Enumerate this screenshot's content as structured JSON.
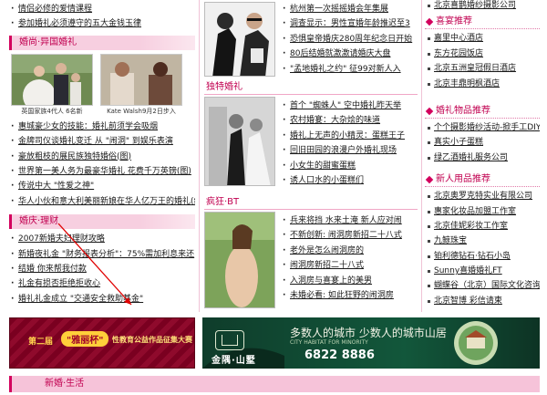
{
  "left": {
    "top_items": [
      "情侣必修的爱情课程",
      "参加婚礼必须遵守的五大金钱玉律"
    ],
    "section1_title": "婚尚·异国婚礼",
    "photos": [
      {
        "caption": "英国家族4代人 6名新"
      },
      {
        "caption": "Kate Walsh9月2日步入"
      }
    ],
    "section1_items": [
      "惠城豪少女的技能：婚礼前须学会吸烟",
      "金牌司仪谈婚礼变迁 从 \"闹洞\" 到娱乐表演",
      "豪放粗枝的展民族独特婚俗(图)",
      "世界第一美人务为最豪华婚礼 花费千万英镑(图)",
      "传说中大 \"性爱之神\"",
      "华人小伙和意大利美丽新娘在华人亿万王的婚礼(组图)"
    ],
    "section2_title": "婚庆·理财",
    "section2_items": [
      "2007新婚夫妇理财攻略",
      "新婚夜礼金 \"财务报表分析\"：75%需加利息来还",
      "结婚 你来帮我付款",
      "礼金有损否拒绝拒收心",
      "婚礼礼金成立 \"交通安全救助基金\""
    ]
  },
  "middle": {
    "block1_items": [
      "杭州第一次摇摇婚会年集展",
      "调查显示：男性宣婚年龄推迟至3",
      "恐惧皇帝婚庆280周年纪念日开始",
      "80后结婚就激激请婚庆大盘",
      "\"孟地婚礼之约\" 征99对新人入"
    ],
    "section2_title": "独特婚礼",
    "block2_items": [
      "首个 \"蜘蛛人\" 空中婚礼昨天举",
      "农村婚宴：大杂烩的味道",
      "婚礼上无声的小精灵：蛋糕王子",
      "回旧田园的浪漫户外婚礼现场",
      "小女生的甜蜜蛋糕",
      "诱人口水的小蛋糕们"
    ],
    "section3_title": "疯狂·BT",
    "block3_items": [
      "兵来将挡 水来土淹 新人应对闹",
      "不新创新: 闹洞房新招二十八式",
      "老外是怎么闹洞房的",
      "闹洞房新招二十八式",
      "入洞房与喜宴上的美男",
      "未婚必看: 如此狂野的闹洞房"
    ]
  },
  "right": {
    "top_items": [
      "北京喜鹊婚纱摄影公司"
    ],
    "section1_title": "喜宴推荐",
    "section1_items": [
      "嘉里中心酒店",
      "东方花园饭店",
      "北京五洲皇冠假日酒店",
      "北京丰鼎明枫酒店"
    ],
    "section2_title": "婚礼物品推荐",
    "section2_items": [
      "个个摄影婚纱活动-掀手工DIY糖",
      "真实小子蛋糕",
      "绿乙酒婚礼服务公司"
    ],
    "section3_title": "新人用品推荐",
    "section3_items": [
      "北京奥罗克特实业有限公司",
      "惠家化妆品加盟工作室",
      "北京佳妮彩妆工作室",
      "九鲸珠宝",
      "铂利德钻石·钻石小岛",
      "Sunny喜婚婚礼FT",
      "蝴蝶谷（北京）国际文化咨询中",
      "北京智博 彩信请柬"
    ]
  },
  "banners": {
    "left_text_a": "第二届",
    "left_text_b": "\"雅丽杯\"",
    "left_text_c": "性教育公益作品征集大赛",
    "right_brand": "金隅·山墅",
    "right_slogan": "多数人的城市 少数人的城市山居",
    "right_phone": "6822 8886",
    "right_small": "CITY HABITAT FOR MINORITY"
  },
  "bottom": {
    "title": "新婚·生活"
  }
}
